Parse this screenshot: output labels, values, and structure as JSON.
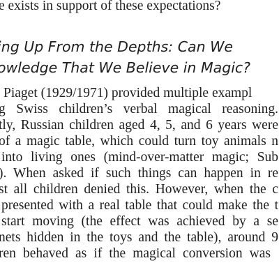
{
  "document": {
    "intro_tail": "e exists in support of these expectations?",
    "section_heading": [
      "ing Up From the Depths: Can We",
      "owledge That We Believe in Magic?"
    ],
    "paragraph_lines": [
      "Piaget (1929/1971) provided multiple exampl",
      "g Swiss children’s verbal magical reasoning.",
      "tly, Russian children aged 4, 5, and 6 years were",
      "of a magic table, which could turn toy animals n",
      "into living ones (mind-over-matter magic; Sub",
      "). When asked if such things can happen in re",
      "st all children denied this. However, when the c",
      "presented with a real table that could make the t",
      "start moving (the effect was achieved by a se",
      "nets hidden in the toys and the table), around 9",
      "ren behaved as if the magical conversion was"
    ]
  }
}
